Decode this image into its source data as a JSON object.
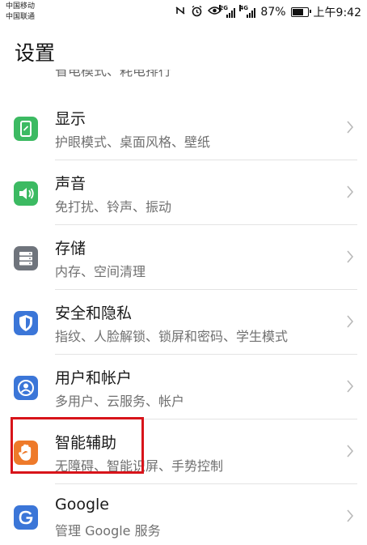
{
  "status_bar": {
    "carrier_1": "中国移动",
    "carrier_2": "中国联通",
    "network_1": "2G",
    "network_2": "4G",
    "battery": "87%",
    "battery_level": 0.87,
    "time": "上午9:42"
  },
  "header": {
    "title": "设置"
  },
  "partial_item_subtitle": "省电模式、耗电排行",
  "items": [
    {
      "title": "显示",
      "subtitle": "护眼模式、桌面风格、壁纸",
      "icon": "display-icon",
      "color": "#3cba62"
    },
    {
      "title": "声音",
      "subtitle": "免打扰、铃声、振动",
      "icon": "sound-icon",
      "color": "#3cba62"
    },
    {
      "title": "存储",
      "subtitle": "内存、空间清理",
      "icon": "storage-icon",
      "color": "#6f747c"
    },
    {
      "title": "安全和隐私",
      "subtitle": "指纹、人脸解锁、锁屏和密码、学生模式",
      "icon": "shield-icon",
      "color": "#3b76d8"
    },
    {
      "title": "用户和帐户",
      "subtitle": "多用户、云服务、帐户",
      "icon": "user-icon",
      "color": "#3b76d8"
    },
    {
      "title": "智能辅助",
      "subtitle": "无障碍、智能识屏、手势控制",
      "icon": "hand-icon",
      "color": "#ee7a2a"
    },
    {
      "title": "Google",
      "subtitle": "管理 Google 服务",
      "icon": "google-icon",
      "color": "#3b76d8"
    }
  ],
  "highlight_color": "#d8141a"
}
